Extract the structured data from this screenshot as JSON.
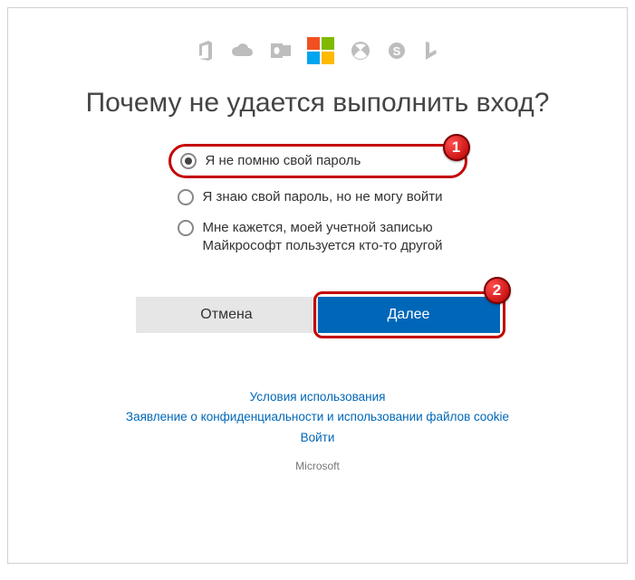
{
  "header": {
    "icons": [
      "office-icon",
      "onedrive-icon",
      "outlook-icon",
      "microsoft-logo",
      "xbox-icon",
      "skype-icon",
      "bing-icon"
    ]
  },
  "heading": "Почему не удается выполнить вход?",
  "options": [
    {
      "label": "Я не помню свой пароль",
      "checked": true,
      "highlighted": true
    },
    {
      "label": "Я знаю свой пароль, но не могу войти",
      "checked": false,
      "highlighted": false
    },
    {
      "label": "Мне кажется, моей учетной записью Майкрософт пользуется кто-то другой",
      "checked": false,
      "highlighted": false
    }
  ],
  "markers": {
    "1": "1",
    "2": "2"
  },
  "buttons": {
    "cancel": "Отмена",
    "next": "Далее"
  },
  "footer": {
    "terms": "Условия использования",
    "privacy": "Заявление о конфиденциальности и использовании файлов cookie",
    "signin": "Войти",
    "brand": "Microsoft"
  }
}
